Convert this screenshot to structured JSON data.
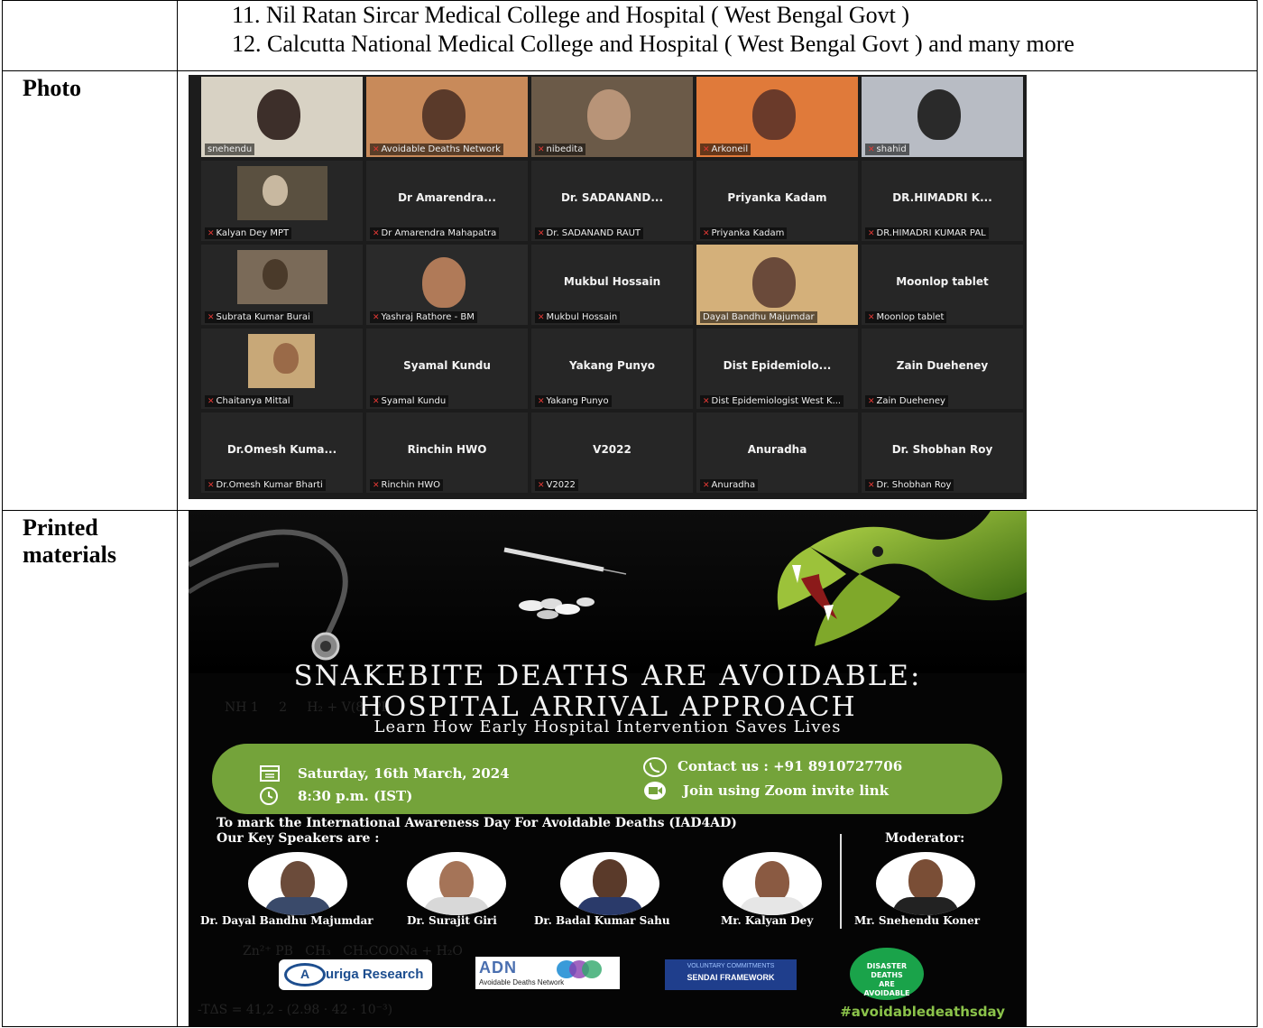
{
  "rows": [
    {
      "label": "",
      "list": [
        "11. Nil Ratan Sircar Medical College and Hospital ( West Bengal Govt )",
        "12. Calcutta National Medical College and Hospital ( West Bengal Govt ) and many more"
      ]
    },
    {
      "label": "Photo"
    },
    {
      "label": "Printed materials"
    }
  ],
  "zoom": {
    "tiles": [
      {
        "name": "",
        "label": "snehendu",
        "mic": false
      },
      {
        "name": "",
        "label": "Avoidable Deaths Network",
        "mic": true
      },
      {
        "name": "",
        "label": "nibedita",
        "mic": true
      },
      {
        "name": "",
        "label": "Arkoneil",
        "mic": true
      },
      {
        "name": "",
        "label": "shahid",
        "mic": true
      },
      {
        "name": "",
        "label": "Kalyan Dey MPT",
        "mic": true
      },
      {
        "name": "Dr Amarendra...",
        "label": "Dr Amarendra Mahapatra",
        "mic": true
      },
      {
        "name": "Dr. SADANAND...",
        "label": "Dr. SADANAND RAUT",
        "mic": true
      },
      {
        "name": "Priyanka Kadam",
        "label": "Priyanka Kadam",
        "mic": true
      },
      {
        "name": "DR.HIMADRI K...",
        "label": "DR.HIMADRI KUMAR PAL",
        "mic": true
      },
      {
        "name": "",
        "label": "Subrata Kumar Burai",
        "mic": true
      },
      {
        "name": "",
        "label": "Yashraj Rathore - BM",
        "mic": true
      },
      {
        "name": "Mukbul Hossain",
        "label": "Mukbul Hossain",
        "mic": true
      },
      {
        "name": "",
        "label": "Dayal Bandhu Majumdar",
        "mic": false
      },
      {
        "name": "Moonlop tablet",
        "label": "Moonlop tablet",
        "mic": true
      },
      {
        "name": "",
        "label": "Chaitanya Mittal",
        "mic": true
      },
      {
        "name": "Syamal Kundu",
        "label": "Syamal Kundu",
        "mic": true
      },
      {
        "name": "Yakang Punyo",
        "label": "Yakang Punyo",
        "mic": true
      },
      {
        "name": "Dist Epidemiolo...",
        "label": "Dist Epidemiologist West K...",
        "mic": true
      },
      {
        "name": "Zain Dueheney",
        "label": "Zain Dueheney",
        "mic": true
      },
      {
        "name": "Dr.Omesh Kuma...",
        "label": "Dr.Omesh Kumar Bharti",
        "mic": true
      },
      {
        "name": "Rinchin HWO",
        "label": "Rinchin HWO",
        "mic": true
      },
      {
        "name": "V2022",
        "label": "V2022",
        "mic": true
      },
      {
        "name": "Anuradha",
        "label": "Anuradha",
        "mic": true
      },
      {
        "name": "Dr. Shobhan Roy",
        "label": "Dr. Shobhan Roy",
        "mic": true
      }
    ]
  },
  "poster": {
    "title_line1": "SNAKEBITE DEATHS ARE AVOIDABLE:",
    "title_line2": "HOSPITAL ARRIVAL APPROACH",
    "subtitle": "Learn How Early Hospital Intervention Saves Lives",
    "date": "Saturday, 16th March, 2024",
    "time": "8:30 p.m. (IST)",
    "contact": "Contact us : +91 8910727706",
    "join": "Join using Zoom invite link",
    "mark_text": "To mark the International Awareness Day For Avoidable Deaths (IAD4AD)",
    "speakers_heading": "Our Key Speakers are :",
    "moderator_heading": "Moderator:",
    "speakers": [
      "Dr. Dayal Bandhu Majumdar",
      "Dr. Surajit Giri",
      "Dr. Badal Kumar Sahu",
      "Mr. Kalyan Dey"
    ],
    "moderator": "Mr. Snehendu Koner",
    "logo_auriga": "uriga Research",
    "logo_adn": "Avoidable Deaths Network",
    "logo_sendai_top": "VOLUNTARY COMMITMENTS",
    "logo_sendai": "SENDAI FRAMEWORK",
    "badge": "DISASTER DEATHS ARE AVOIDABLE",
    "hashtag": "#avoidabledeathsday",
    "accent_green": "#74a33a"
  }
}
